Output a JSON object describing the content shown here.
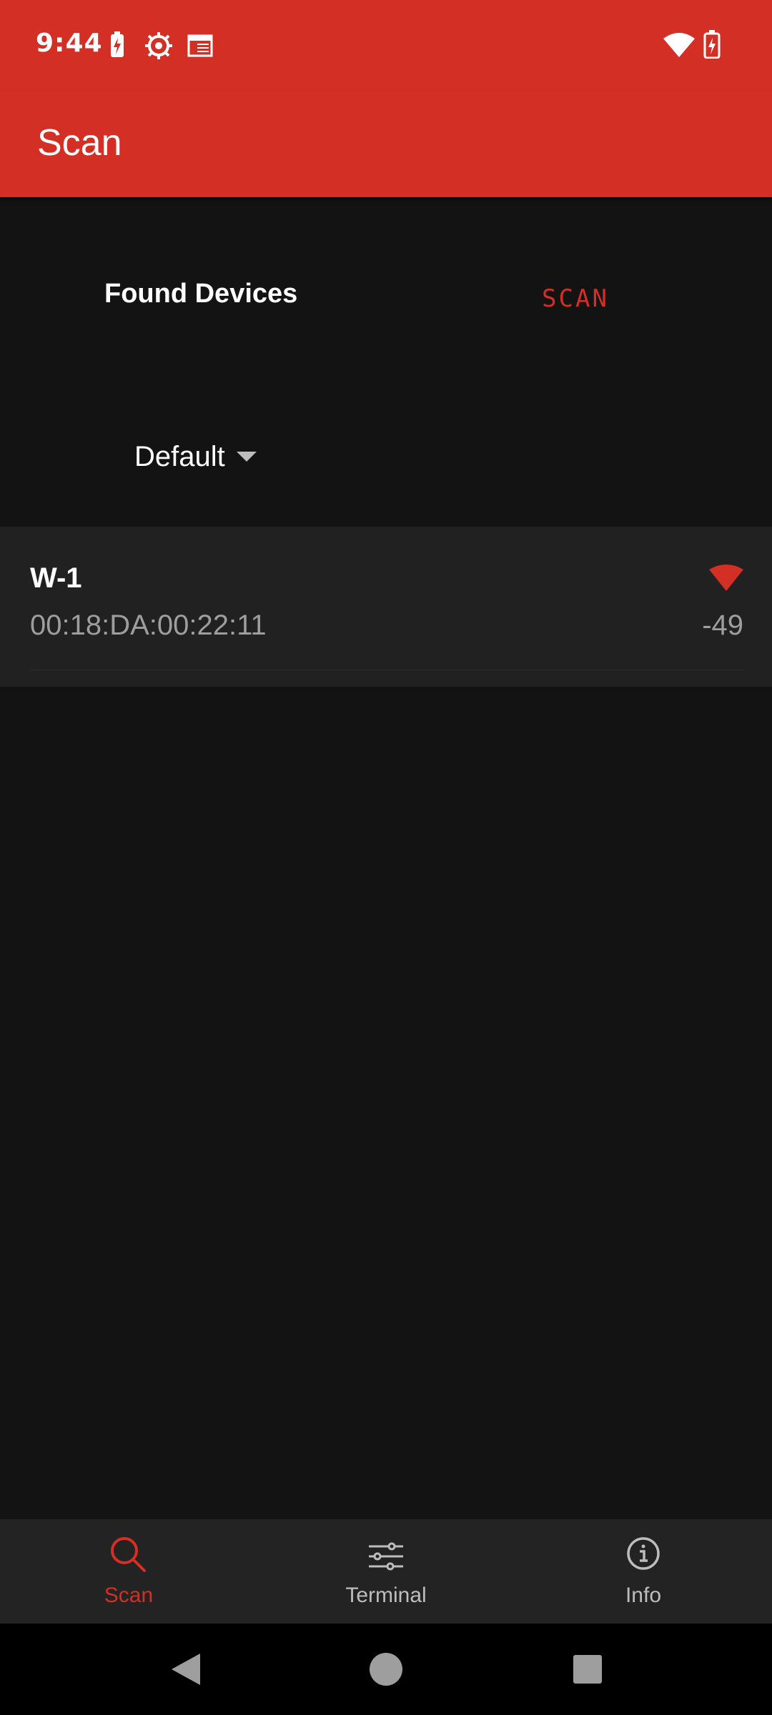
{
  "status_bar": {
    "time": "9:44",
    "left_icons": [
      "battery-charging-icon",
      "settings-gear-icon",
      "calendar-icon"
    ],
    "right_icons": [
      "wifi-icon",
      "battery-charging-icon"
    ]
  },
  "app_bar": {
    "title": "Scan"
  },
  "header": {
    "title": "Found Devices",
    "scan_label": "SCAN"
  },
  "sort": {
    "selected": "Default"
  },
  "devices": [
    {
      "name": "W-1",
      "mac": "00:18:DA:00:22:11",
      "rssi": "-49",
      "signal_icon": "wifi-signal-icon"
    }
  ],
  "bottom_nav": {
    "items": [
      {
        "label": "Scan",
        "icon": "search-icon",
        "active": true
      },
      {
        "label": "Terminal",
        "icon": "sliders-icon",
        "active": false
      },
      {
        "label": "Info",
        "icon": "info-icon",
        "active": false
      }
    ]
  },
  "colors": {
    "accent": "#d32f24",
    "background": "#131313",
    "row_background": "#212121",
    "nav_background": "#232323",
    "inactive": "#bdbdbd"
  }
}
